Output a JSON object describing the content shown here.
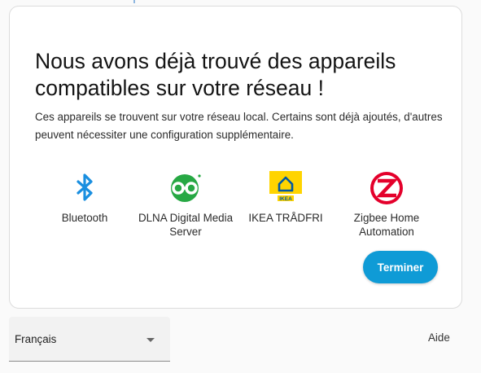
{
  "onboarding": {
    "title": "Nous avons déjà trouvé des appareils compatibles sur votre réseau !",
    "description": "Ces appareils se trouvent sur votre réseau local. Certains sont déjà ajoutés, d'autres peuvent nécessiter une configuration supplémentaire.",
    "integrations": [
      {
        "label": "Bluetooth",
        "icon": "bluetooth-icon"
      },
      {
        "label": "DLNA Digital Media Server",
        "icon": "dlna-icon"
      },
      {
        "label": "IKEA TRÅDFRI",
        "icon": "ikea-logo-icon",
        "logo_text": "IKEA"
      },
      {
        "label": "Zigbee Home Automation",
        "icon": "zigbee-icon"
      }
    ],
    "finish_label": "Terminer"
  },
  "footer": {
    "language_value": "Français",
    "help_label": "Aide"
  },
  "colors": {
    "accent": "#0f9bd6",
    "bluetooth": "#1a8fe0",
    "dlna": "#27a844",
    "ikea_yellow": "#ffd400",
    "ikea_blue": "#0058a3",
    "zigbee_red": "#e4002b"
  }
}
